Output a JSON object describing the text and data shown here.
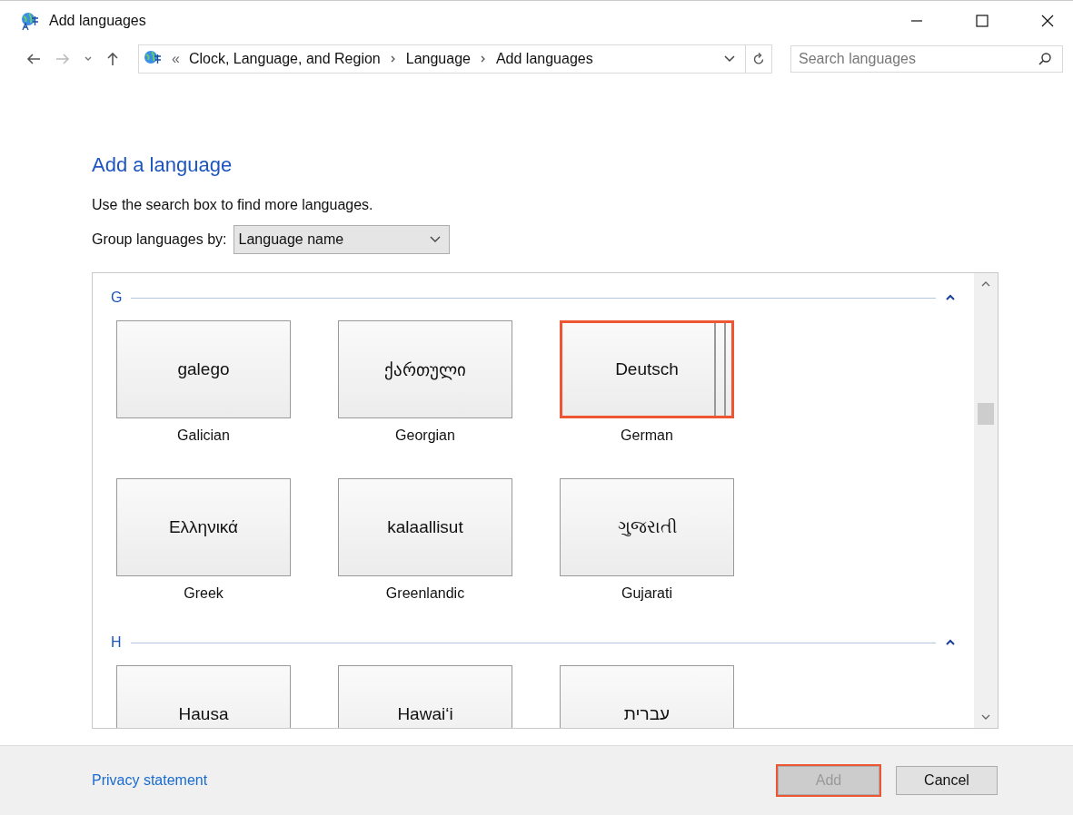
{
  "window": {
    "title": "Add languages"
  },
  "breadcrumb": {
    "overflow": "«",
    "items": [
      "Clock, Language, and Region",
      "Language",
      "Add languages"
    ]
  },
  "search": {
    "placeholder": "Search languages"
  },
  "heading": "Add a language",
  "hint": "Use the search box to find more languages.",
  "group_by": {
    "label": "Group languages by:",
    "value": "Language name"
  },
  "groups": [
    {
      "letter": "G",
      "expanded": true,
      "languages": [
        {
          "native": "galego",
          "name": "Galician",
          "highlighted": false
        },
        {
          "native": "ქართული",
          "name": "Georgian",
          "highlighted": false
        },
        {
          "native": "Deutsch",
          "name": "German",
          "highlighted": true
        },
        {
          "native": "Ελληνικά",
          "name": "Greek",
          "highlighted": false
        },
        {
          "native": "kalaallisut",
          "name": "Greenlandic",
          "highlighted": false
        },
        {
          "native": "ગુજરાતી",
          "name": "Gujarati",
          "highlighted": false
        }
      ]
    },
    {
      "letter": "H",
      "expanded": true,
      "languages": [
        {
          "native": "Hausa",
          "highlighted": false
        },
        {
          "native": "Hawaiʻi",
          "highlighted": false
        },
        {
          "native": "עברית",
          "highlighted": false
        }
      ]
    }
  ],
  "footer": {
    "link": "Privacy statement",
    "buttons": [
      {
        "label": "Add",
        "disabled": true,
        "highlighted": true
      },
      {
        "label": "Cancel",
        "disabled": false,
        "highlighted": false
      }
    ]
  }
}
